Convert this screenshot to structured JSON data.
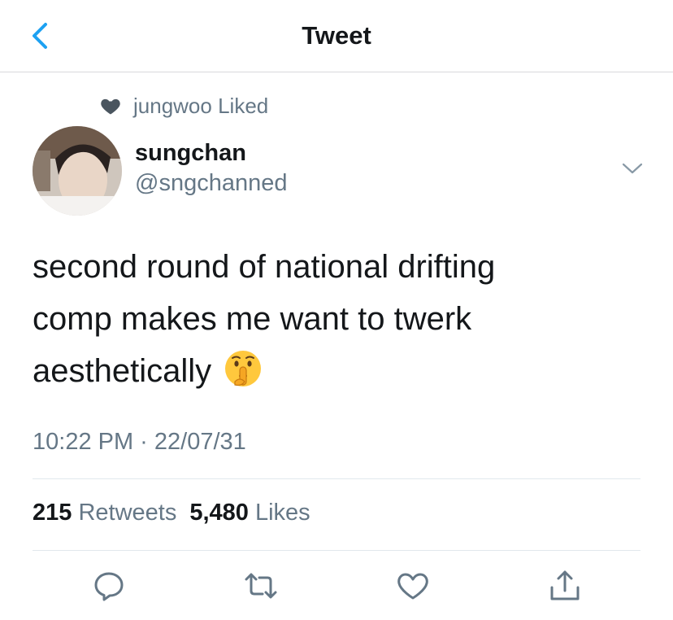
{
  "header": {
    "title": "Tweet"
  },
  "social_context": {
    "text": "jungwoo Liked"
  },
  "author": {
    "display_name": "sungchan",
    "handle": "@sngchanned"
  },
  "tweet": {
    "line1": "second round of national drifting",
    "line2": "comp makes me want to twerk",
    "line3": "aesthetically",
    "emoji": "shushing-face",
    "timestamp": "10:22 PM · 22/07/31"
  },
  "stats": {
    "retweets_count": "215",
    "retweets_label": "Retweets",
    "likes_count": "5,480",
    "likes_label": "Likes"
  },
  "colors": {
    "accent": "#1da1f2",
    "secondary_text": "#657786",
    "icon": "#657786"
  },
  "icons": [
    "back-chevron-icon",
    "heart-icon",
    "caret-down-icon",
    "reply-icon",
    "retweet-icon",
    "like-icon",
    "share-icon"
  ]
}
